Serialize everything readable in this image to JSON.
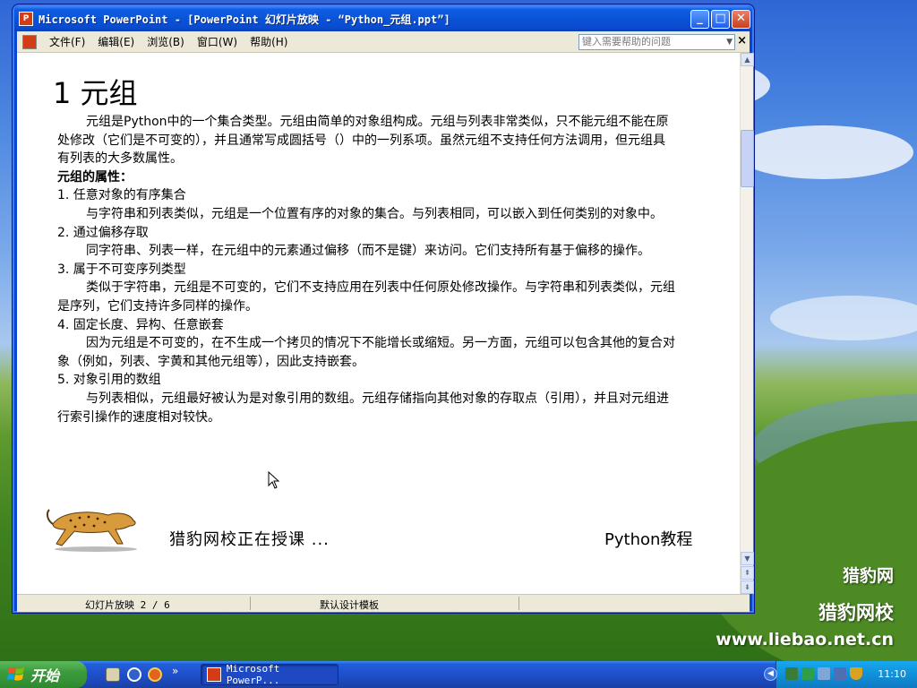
{
  "window": {
    "title": "Microsoft PowerPoint - [PowerPoint 幻灯片放映 - “Python_元组.ppt”]",
    "app_icon": "powerpoint-icon",
    "controls": {
      "minimize": "minimize-icon",
      "maximize": "maximize-icon",
      "close": "close-icon"
    }
  },
  "menubar": {
    "items": [
      "文件(F)",
      "编辑(E)",
      "浏览(B)",
      "窗口(W)",
      "帮助(H)"
    ],
    "help_placeholder": "键入需要帮助的问题",
    "close_glyph": "×"
  },
  "slide": {
    "title": "1 元组",
    "intro": "元组是Python中的一个集合类型。元组由简单的对象组构成。元组与列表非常类似，只不能元组不能在原处修改（它们是不可变的），并且通常写成圆括号（）中的一列系项。虽然元组不支持任何方法调用，但元组具有列表的大多数属性。",
    "properties_heading": "元组的属性：",
    "items": [
      {
        "heading": "1. 任意对象的有序集合",
        "text": "与字符串和列表类似，元组是一个位置有序的对象的集合。与列表相同，可以嵌入到任何类别的对象中。"
      },
      {
        "heading": "2. 通过偏移存取",
        "text": "同字符串、列表一样，在元组中的元素通过偏移（而不是键）来访问。它们支持所有基于偏移的操作。"
      },
      {
        "heading": "3. 属于不可变序列类型",
        "text": "类似于字符串，元组是不可变的，它们不支持应用在列表中任何原处修改操作。与字符串和列表类似，元组是序列，它们支持许多同样的操作。"
      },
      {
        "heading": "4. 固定长度、异构、任意嵌套",
        "text": "因为元组是不可变的，在不生成一个拷贝的情况下不能增长或缩短。另一方面，元组可以包含其他的复合对象（例如，列表、字黄和其他元组等），因此支持嵌套。"
      },
      {
        "heading": "5. 对象引用的数组",
        "text": "与列表相似，元组最好被认为是对象引用的数组。元组存储指向其他对象的存取点（引用），并且对元组进行索引操作的速度相对较快。"
      }
    ],
    "footer_status": "猎豹网校正在授课 ...",
    "footer_brand": "Python教程"
  },
  "statusbar": {
    "slide_info": "幻灯片放映 2 / 6",
    "template": "默认设计模板"
  },
  "desktop_watermark": {
    "line1": "猎豹网",
    "line2": "猎豹网校",
    "url": "www.liebao.net.cn"
  },
  "taskbar": {
    "start_label": "开始",
    "active_task": "Microsoft PowerP...",
    "quicklaunch_more": "»",
    "clock": "11:10"
  },
  "colors": {
    "xp_blue": "#0a46d4",
    "menu_bg": "#ece9d8",
    "start_green": "#3c9b3c",
    "ppt_red": "#d33c15"
  }
}
